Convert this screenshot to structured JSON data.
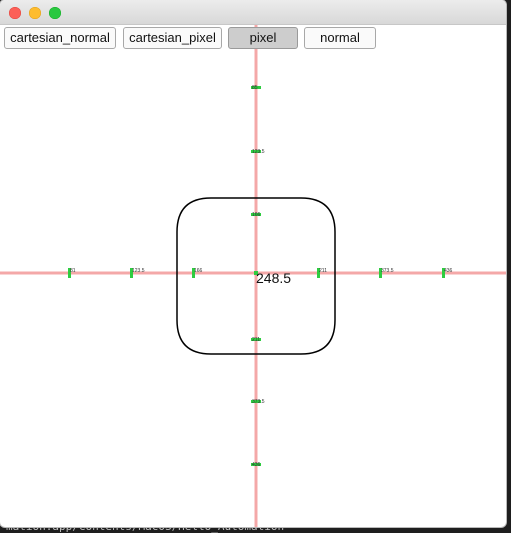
{
  "toolbar": {
    "buttons": [
      "cartesian_normal",
      "cartesian_pixel",
      "pixel",
      "normal"
    ],
    "active": "pixel"
  },
  "canvas": {
    "center_value": "248.5",
    "x_ticks": [
      "81",
      "123.5",
      "166",
      "211",
      "373.5",
      "436"
    ],
    "y_ticks": [
      "85",
      "123.5",
      "166",
      "211",
      "373.5",
      "436"
    ],
    "axis_color": "#f4a8a8",
    "tick_color": "#2ecc40",
    "shape_color": "#000000"
  },
  "terminal": {
    "path": "mation.app/Contents/MacOS/Hello_Automation"
  }
}
